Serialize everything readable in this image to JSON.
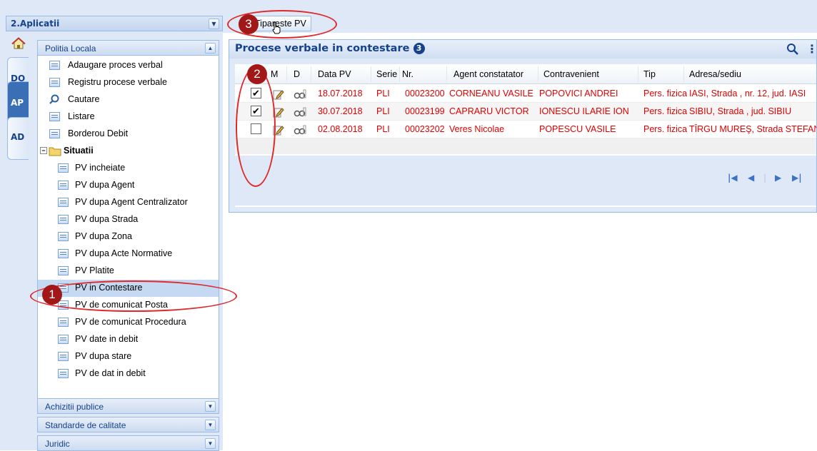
{
  "sidebar": {
    "app_title": "2.Aplicatii",
    "vertical_tabs": [
      {
        "label": "DO",
        "active": false
      },
      {
        "label": "AP",
        "active": true
      },
      {
        "label": "AD",
        "active": false
      }
    ],
    "group_politia": "Politia Locala",
    "items": [
      {
        "label": "Adaugare proces verbal"
      },
      {
        "label": "Registru procese verbale"
      },
      {
        "label": "Cautare"
      },
      {
        "label": "Listare"
      },
      {
        "label": "Borderou Debit"
      }
    ],
    "folder": "Situatii",
    "situatii": [
      {
        "label": "PV incheiate"
      },
      {
        "label": "PV dupa Agent"
      },
      {
        "label": "PV dupa Agent Centralizator"
      },
      {
        "label": "PV dupa Strada"
      },
      {
        "label": "PV dupa Zona"
      },
      {
        "label": "PV dupa Acte Normative"
      },
      {
        "label": "PV Platite"
      },
      {
        "label": "PV in Contestare"
      },
      {
        "label": "PV de comunicat Posta"
      },
      {
        "label": "PV de comunicat Procedura"
      },
      {
        "label": "PV date in debit"
      },
      {
        "label": "PV dupa stare"
      },
      {
        "label": "PV de dat in debit"
      }
    ],
    "groups_bottom": [
      {
        "label": "Achizitii publice"
      },
      {
        "label": "Standarde de calitate"
      },
      {
        "label": "Juridic"
      }
    ]
  },
  "toolbar": {
    "print_button": "Tipareste PV"
  },
  "panel": {
    "title": "Procese verbale in contestare",
    "badge": "3"
  },
  "grid": {
    "columns": [
      "M",
      "D",
      "Data PV",
      "Serie",
      "Nr.",
      "Agent constatator",
      "Contravenient",
      "Tip",
      "Adresa/sediu"
    ],
    "rows": [
      {
        "checked": true,
        "check_mark": "✔",
        "data_pv": "18.07.2018",
        "serie": "PLI",
        "nr": "00023200",
        "agent": "CORNEANU VASILE",
        "contravenient": "POPOVICI ANDREI",
        "tip": "Pers. fizica",
        "adresa": "IASI, Strada , nr. 12, jud. IASI"
      },
      {
        "checked": true,
        "check_mark": "✔",
        "data_pv": "30.07.2018",
        "serie": "PLI",
        "nr": "00023199",
        "agent": "CAPRARU VICTOR",
        "contravenient": "IONESCU ILARIE ION",
        "tip": "Pers. fizica",
        "adresa": "SIBIU, Strada , jud. SIBIU"
      },
      {
        "checked": false,
        "check_mark": "",
        "data_pv": "02.08.2018",
        "serie": "PLI",
        "nr": "00023202",
        "agent": "Veres Nicolae",
        "contravenient": "POPESCU VASILE",
        "tip": "Pers. fizica",
        "adresa": "TÎRGU MUREŞ, Strada STEFAN"
      }
    ]
  },
  "pager": {
    "first": "|◀",
    "prev": "◀",
    "next": "▶",
    "last": "▶|"
  },
  "callouts": [
    "1",
    "2",
    "3"
  ],
  "colors": {
    "accent": "#15428b",
    "row_text": "#e00000",
    "annotation": "#e0282a"
  }
}
